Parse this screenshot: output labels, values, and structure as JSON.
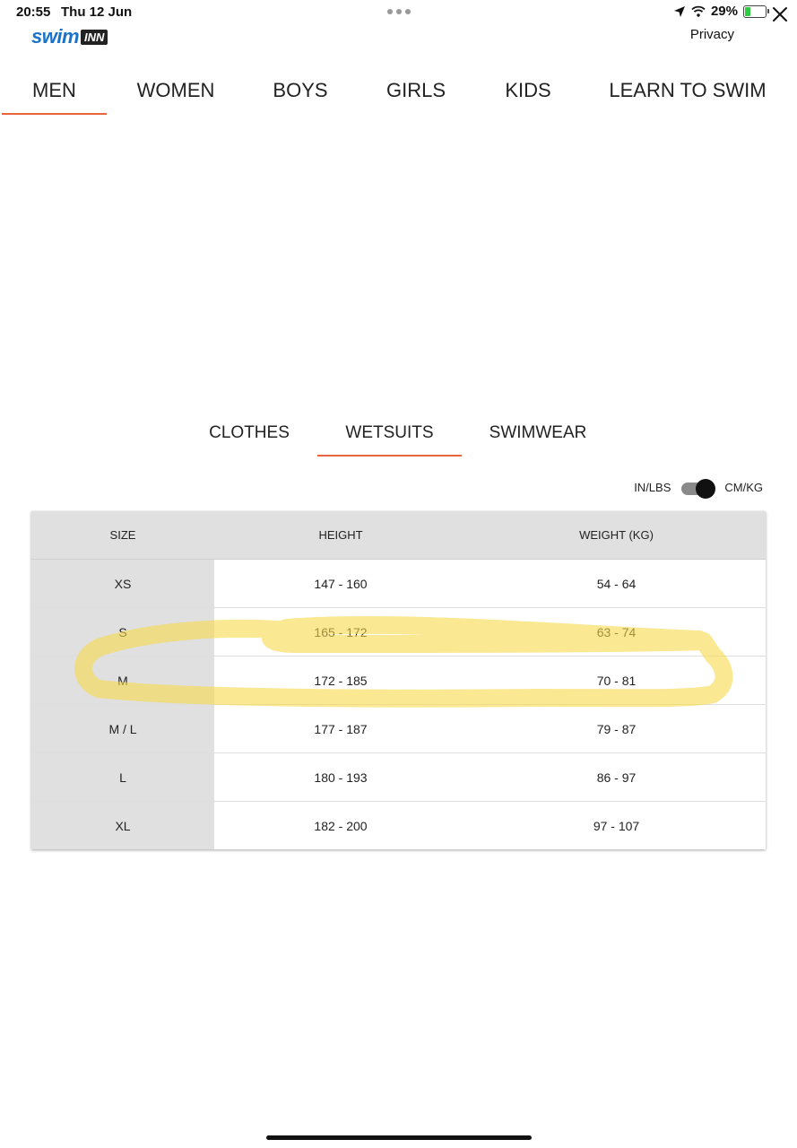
{
  "status_bar": {
    "time": "20:55",
    "date": "Thu 12 Jun",
    "battery_percent": "29%",
    "battery_level": 0.29,
    "icons": [
      "location-arrow-icon",
      "wifi-icon",
      "battery-charging-icon"
    ]
  },
  "header": {
    "logo_primary": "swim",
    "logo_secondary": "INN",
    "privacy_label": "Privacy",
    "close_icon": "close-icon"
  },
  "main_tabs": [
    {
      "label": "MEN",
      "active": true
    },
    {
      "label": "WOMEN",
      "active": false
    },
    {
      "label": "BOYS",
      "active": false
    },
    {
      "label": "GIRLS",
      "active": false
    },
    {
      "label": "KIDS",
      "active": false
    },
    {
      "label": "LEARN TO SWIM",
      "active": false
    }
  ],
  "category_tabs": [
    {
      "label": "CLOTHES",
      "active": false
    },
    {
      "label": "WETSUITS",
      "active": true
    },
    {
      "label": "SWIMWEAR",
      "active": false
    }
  ],
  "unit_toggle": {
    "left_label": "IN/LBS",
    "right_label": "CM/KG",
    "selected": "CM/KG"
  },
  "size_table": {
    "headers": [
      "SIZE",
      "HEIGHT",
      "WEIGHT (KG)"
    ],
    "rows": [
      [
        "XS",
        "147 - 160",
        "54 - 64"
      ],
      [
        "S",
        "165 - 172",
        "63 - 74"
      ],
      [
        "M",
        "172 - 185",
        "70 - 81"
      ],
      [
        "M / L",
        "177 - 187",
        "79 - 87"
      ],
      [
        "L",
        "180 - 193",
        "86 - 97"
      ],
      [
        "XL",
        "182 - 200",
        "97 - 107"
      ]
    ]
  },
  "colors": {
    "accent": "#e8643c",
    "logo_blue": "#1a73c9",
    "table_header_bg": "#e0e0e0",
    "highlight": "#f7d94a"
  }
}
